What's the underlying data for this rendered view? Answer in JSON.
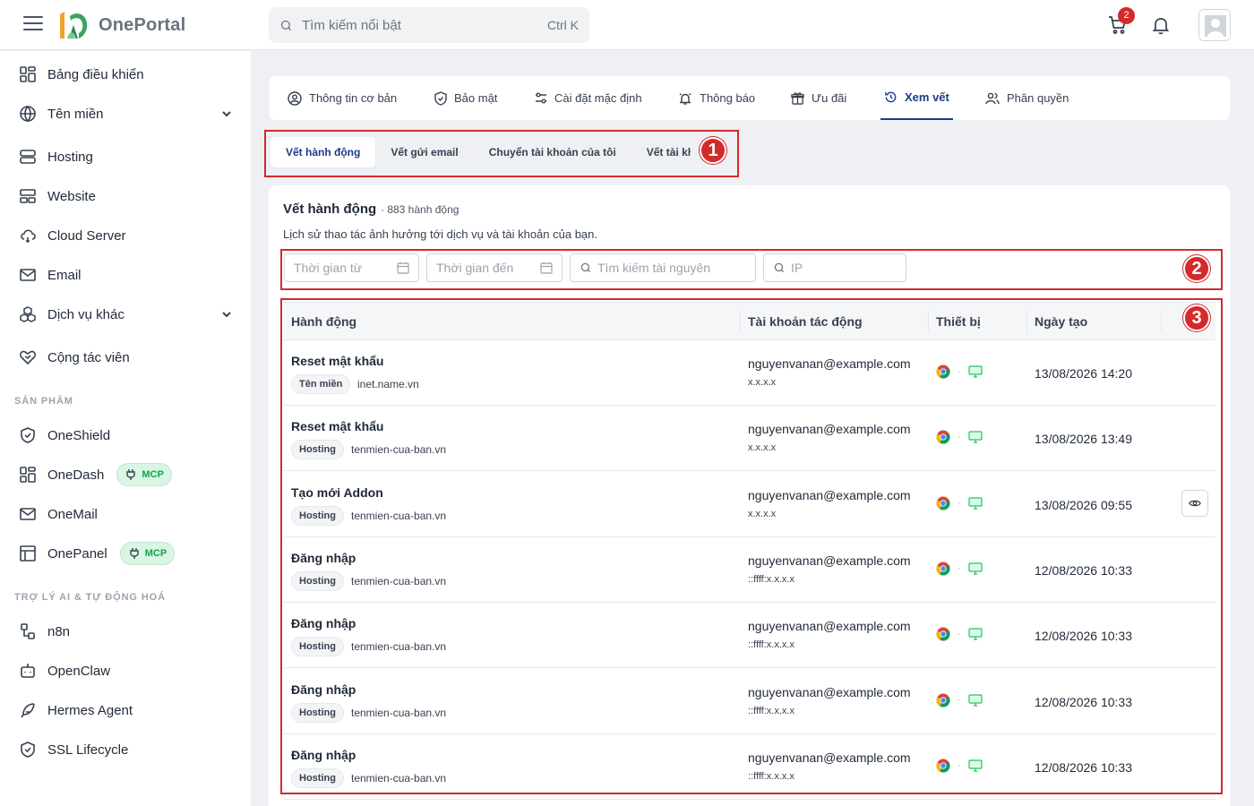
{
  "header": {
    "brand": "OnePortal",
    "search_placeholder": "Tìm kiếm nổi bật",
    "search_shortcut": "Ctrl K",
    "cart_count": "2"
  },
  "sidebar": {
    "items": [
      {
        "label": "Bảng điều khiển",
        "icon": "dashboard-icon"
      },
      {
        "label": "Tên miền",
        "icon": "globe-icon",
        "expandable": true
      },
      {
        "label": "Hosting",
        "icon": "server-icon"
      },
      {
        "label": "Website",
        "icon": "website-icon"
      },
      {
        "label": "Cloud Server",
        "icon": "cloud-icon"
      },
      {
        "label": "Email",
        "icon": "mail-icon"
      },
      {
        "label": "Dịch vụ khác",
        "icon": "boxes-icon",
        "expandable": true
      },
      {
        "label": "Cộng tác viên",
        "icon": "handshake-icon"
      }
    ],
    "products_title": "SẢN PHẨM",
    "products": [
      {
        "label": "OneShield",
        "icon": "shield-icon"
      },
      {
        "label": "OneDash",
        "icon": "dashboard-icon",
        "badge": "MCP"
      },
      {
        "label": "OneMail",
        "icon": "mail-icon"
      },
      {
        "label": "OnePanel",
        "icon": "panel-icon",
        "badge": "MCP"
      }
    ],
    "ai_title": "TRỢ LÝ AI & TỰ ĐỘNG HOÁ",
    "ai_items": [
      {
        "label": "n8n",
        "icon": "workflow-icon"
      },
      {
        "label": "OpenClaw",
        "icon": "bot-icon"
      },
      {
        "label": "Hermes Agent",
        "icon": "feather-icon"
      },
      {
        "label": "SSL Lifecycle",
        "icon": "shield-check-icon"
      }
    ]
  },
  "tabs": [
    {
      "label": "Thông tin cơ bản",
      "icon": "user-circle-icon"
    },
    {
      "label": "Bảo mật",
      "icon": "shield-icon"
    },
    {
      "label": "Cài đặt mặc định",
      "icon": "settings-sliders-icon"
    },
    {
      "label": "Thông báo",
      "icon": "bell-icon"
    },
    {
      "label": "Ưu đãi",
      "icon": "gift-icon"
    },
    {
      "label": "Xem vết",
      "icon": "history-icon",
      "active": true
    },
    {
      "label": "Phân quyền",
      "icon": "users-icon"
    }
  ],
  "subtabs": [
    {
      "label": "Vết hành động",
      "active": true
    },
    {
      "label": "Vết gửi email"
    },
    {
      "label": "Chuyển tài khoản của tôi"
    },
    {
      "label": "Vết tài kho"
    }
  ],
  "content": {
    "title": "Vết hành động",
    "count": "· 883 hành động",
    "description": "Lịch sử thao tác ảnh hưởng tới dịch vụ và tài khoản của bạn."
  },
  "filters": {
    "from_placeholder": "Thời gian từ",
    "to_placeholder": "Thời gian đến",
    "resource_placeholder": "Tìm kiếm tài nguyên",
    "ip_placeholder": "IP"
  },
  "table": {
    "headers": [
      "Hành động",
      "Tài khoản tác động",
      "Thiết bị",
      "Ngày tạo"
    ],
    "rows": [
      {
        "action": "Reset mật khẩu",
        "tag": "Tên miền",
        "resource": "inet.name.vn",
        "account": "nguyenvanan@example.com",
        "ip": "x.x.x.x",
        "date": "13/08/2026 14:20"
      },
      {
        "action": "Reset mật khẩu",
        "tag": "Hosting",
        "resource": "tenmien-cua-ban.vn",
        "account": "nguyenvanan@example.com",
        "ip": "x.x.x.x",
        "date": "13/08/2026 13:49"
      },
      {
        "action": "Tạo mới Addon",
        "tag": "Hosting",
        "resource": "tenmien-cua-ban.vn",
        "account": "nguyenvanan@example.com",
        "ip": "x.x.x.x",
        "date": "13/08/2026 09:55",
        "show_view": true
      },
      {
        "action": "Đăng nhập",
        "tag": "Hosting",
        "resource": "tenmien-cua-ban.vn",
        "account": "nguyenvanan@example.com",
        "ip": "::ffff:x.x.x.x",
        "date": "12/08/2026 10:33"
      },
      {
        "action": "Đăng nhập",
        "tag": "Hosting",
        "resource": "tenmien-cua-ban.vn",
        "account": "nguyenvanan@example.com",
        "ip": "::ffff:x.x.x.x",
        "date": "12/08/2026 10:33"
      },
      {
        "action": "Đăng nhập",
        "tag": "Hosting",
        "resource": "tenmien-cua-ban.vn",
        "account": "nguyenvanan@example.com",
        "ip": "::ffff:x.x.x.x",
        "date": "12/08/2026 10:33"
      },
      {
        "action": "Đăng nhập",
        "tag": "Hosting",
        "resource": "tenmien-cua-ban.vn",
        "account": "nguyenvanan@example.com",
        "ip": "::ffff:x.x.x.x",
        "date": "12/08/2026 10:33"
      }
    ]
  },
  "annotations": [
    "1",
    "2",
    "3"
  ],
  "colors": {
    "accent": "#1e3a8a",
    "annotation": "#d42a2a",
    "mcp_green": "#16a34a",
    "badge_red": "#d62828"
  }
}
